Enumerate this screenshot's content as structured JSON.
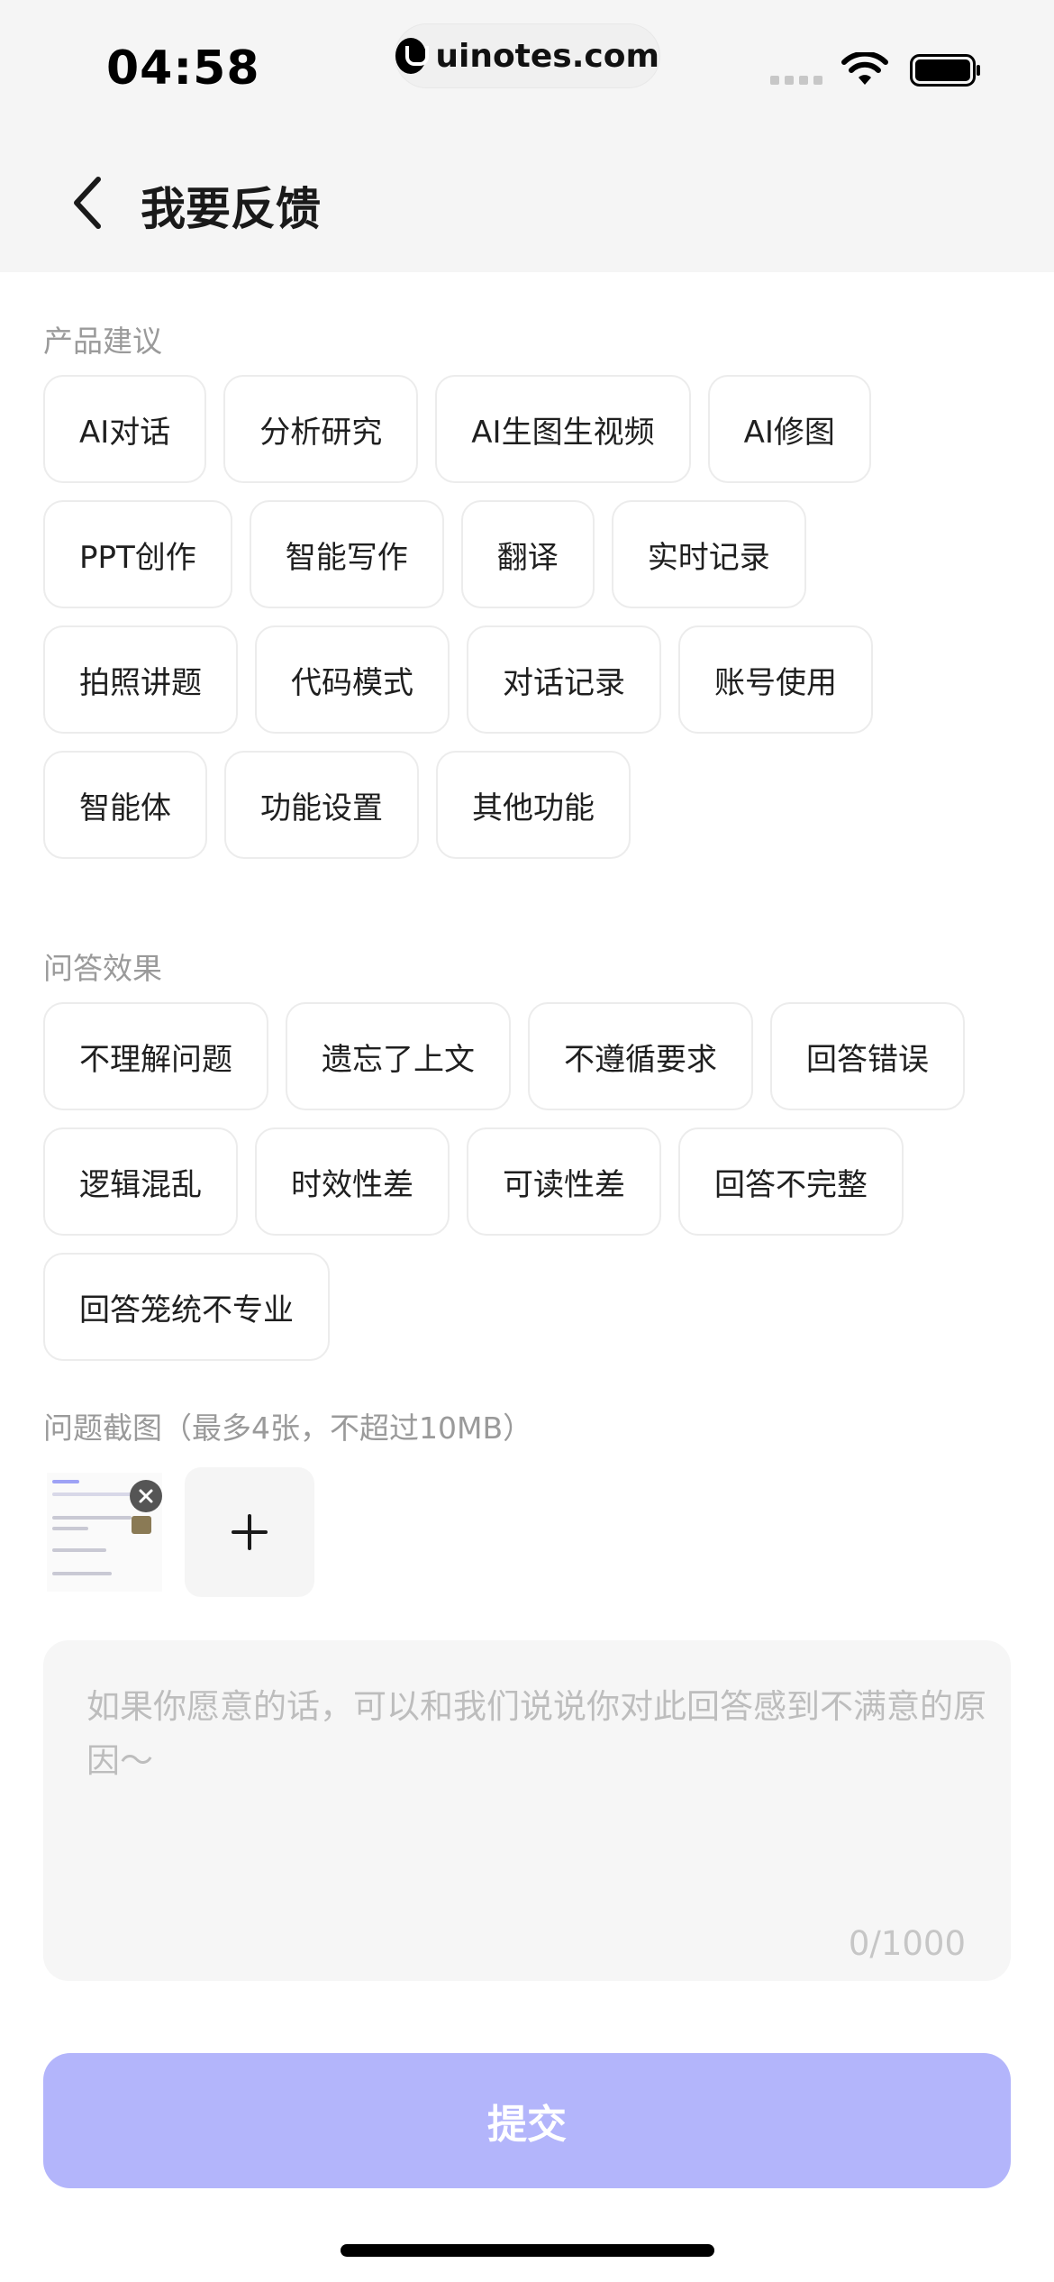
{
  "status_bar": {
    "time": "04:58",
    "url": "uinotes.com"
  },
  "nav": {
    "title": "我要反馈",
    "back_icon": "chevron-left-icon"
  },
  "product_suggestions": {
    "label": "产品建议",
    "tags": [
      "AI对话",
      "分析研究",
      "AI生图生视频",
      "AI修图",
      "PPT创作",
      "智能写作",
      "翻译",
      "实时记录",
      "拍照讲题",
      "代码模式",
      "对话记录",
      "账号使用",
      "智能体",
      "功能设置",
      "其他功能"
    ]
  },
  "answer_quality": {
    "label": "问答效果",
    "tags": [
      "不理解问题",
      "遗忘了上文",
      "不遵循要求",
      "回答错误",
      "逻辑混乱",
      "时效性差",
      "可读性差",
      "回答不完整",
      "回答笼统不专业"
    ]
  },
  "screenshots": {
    "label": "问题截图（最多4张，不超过10MB）",
    "add_icon": "plus-icon",
    "remove_icon": "close-icon"
  },
  "feedback": {
    "placeholder": "如果你愿意的话，可以和我们说说你对此回答感到不满意的原因～",
    "counter": "0/1000"
  },
  "submit": {
    "label": "提交"
  },
  "colors": {
    "accent_disabled": "#b3b5fb",
    "background_top": "#f5f5f5",
    "tag_border": "#ececec",
    "label_gray": "#9a9a9a"
  }
}
